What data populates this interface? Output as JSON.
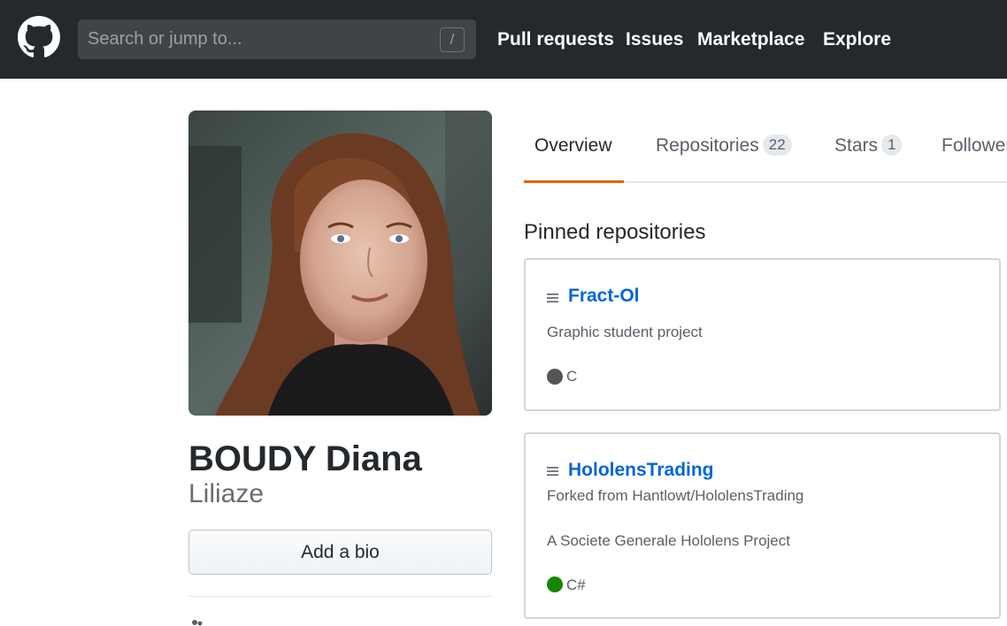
{
  "header": {
    "search_placeholder": "Search or jump to...",
    "search_shortcut": "/",
    "nav": [
      "Pull requests",
      "Issues",
      "Marketplace",
      "Explore"
    ]
  },
  "profile": {
    "full_name": "BOUDY Diana",
    "login": "Liliaze",
    "add_bio_label": "Add a bio"
  },
  "tabs": {
    "overview": "Overview",
    "repositories": "Repositories",
    "repositories_count": "22",
    "stars": "Stars",
    "stars_count": "1",
    "followers": "Followers"
  },
  "pinned": {
    "title": "Pinned repositories",
    "repos": [
      {
        "name": "Fract-Ol",
        "description": "Graphic student project",
        "language": "C",
        "language_color": "#555555"
      },
      {
        "name": "HololensTrading",
        "forked_from": "Forked from Hantlowt/HololensTrading",
        "description": "A Societe Generale Hololens Project",
        "language": "C#",
        "language_color": "#178600"
      }
    ]
  },
  "colors": {
    "header_bg": "#24292e",
    "link": "#0366d6",
    "active_tab_accent": "#e36209"
  }
}
